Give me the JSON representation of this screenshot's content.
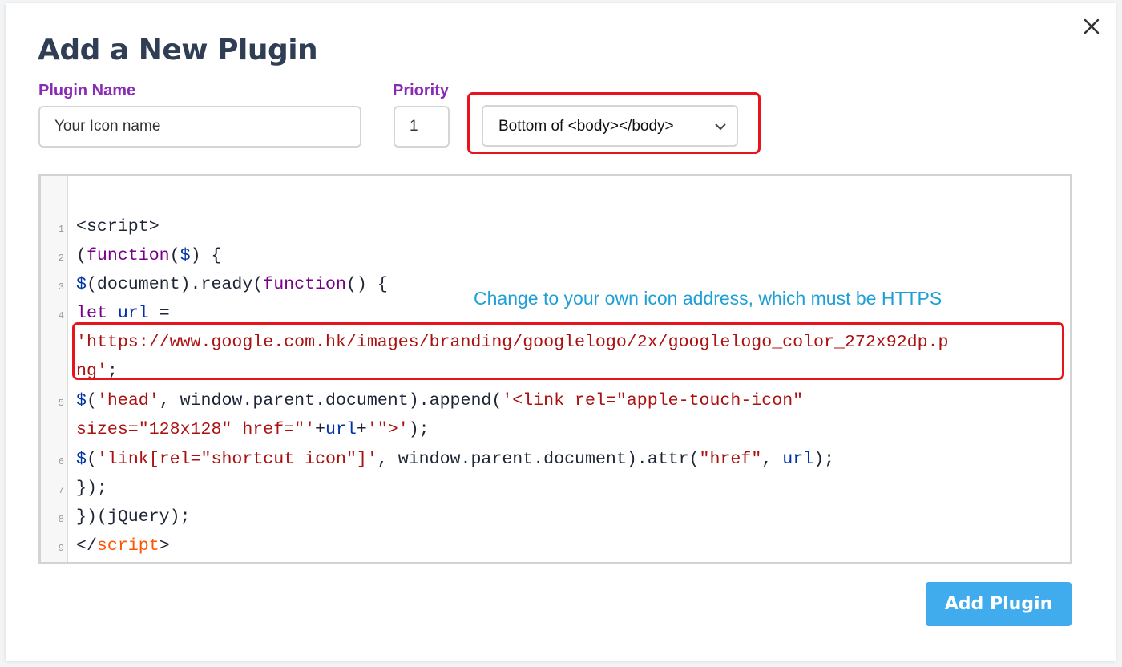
{
  "modal": {
    "title": "Add a New Plugin",
    "close_icon": "close-icon"
  },
  "form": {
    "plugin_name_label": "Plugin Name",
    "plugin_name_value": "Your Icon name",
    "priority_label": "Priority",
    "priority_value": "1",
    "position_select_value": "Bottom of <body></body>",
    "select_icon": "chevron-down-icon"
  },
  "editor": {
    "line_numbers": [
      "1",
      "2",
      "3",
      "4",
      "5",
      "6",
      "7",
      "8",
      "9"
    ],
    "lines": {
      "l1": "<script>",
      "l2_open": "(",
      "l2_kw": "function",
      "l2_open2": "(",
      "l2_var": "$",
      "l2_rest": ") {",
      "l3_var": "$",
      "l3_mid": "(document).ready(",
      "l3_kw": "function",
      "l3_rest": "() {",
      "l4_kw": "let",
      "l4_var": "url",
      "l4_rest": " =",
      "l4b_str": "'https://www.google.com.hk/images/branding/googlelogo/2x/googlelogo_color_272x92dp.p",
      "l4c_str": "ng'",
      "l4c_rest": ";",
      "l5_var": "$",
      "l5_a": "(",
      "l5_str1": "'head'",
      "l5_b": ", window.parent.document).append(",
      "l5_str2": "'<link rel=\"apple-touch-icon\"",
      "l5b_str": "sizes=\"128x128\" href=\"'",
      "l5b_plus1": "+",
      "l5b_var": "url",
      "l5b_plus2": "+",
      "l5b_str2": "'\">'",
      "l5b_rest": ");",
      "l6_var": "$",
      "l6_a": "(",
      "l6_str": "'link[rel=\"shortcut icon\"]'",
      "l6_b": ", window.parent.document).attr(",
      "l6_str2": "\"href\"",
      "l6_c": ", ",
      "l6_var2": "url",
      "l6_d": ");",
      "l7": "});",
      "l8": "})(jQuery);",
      "l9_a": "</",
      "l9_tag": "script",
      "l9_b": ">"
    }
  },
  "annotation": "Change to your own icon address, which must be HTTPS",
  "highlight_color": "#e8141b",
  "accent_color": "#40acee",
  "label_color": "#8a2bb5",
  "actions": {
    "add_plugin_label": "Add Plugin"
  }
}
